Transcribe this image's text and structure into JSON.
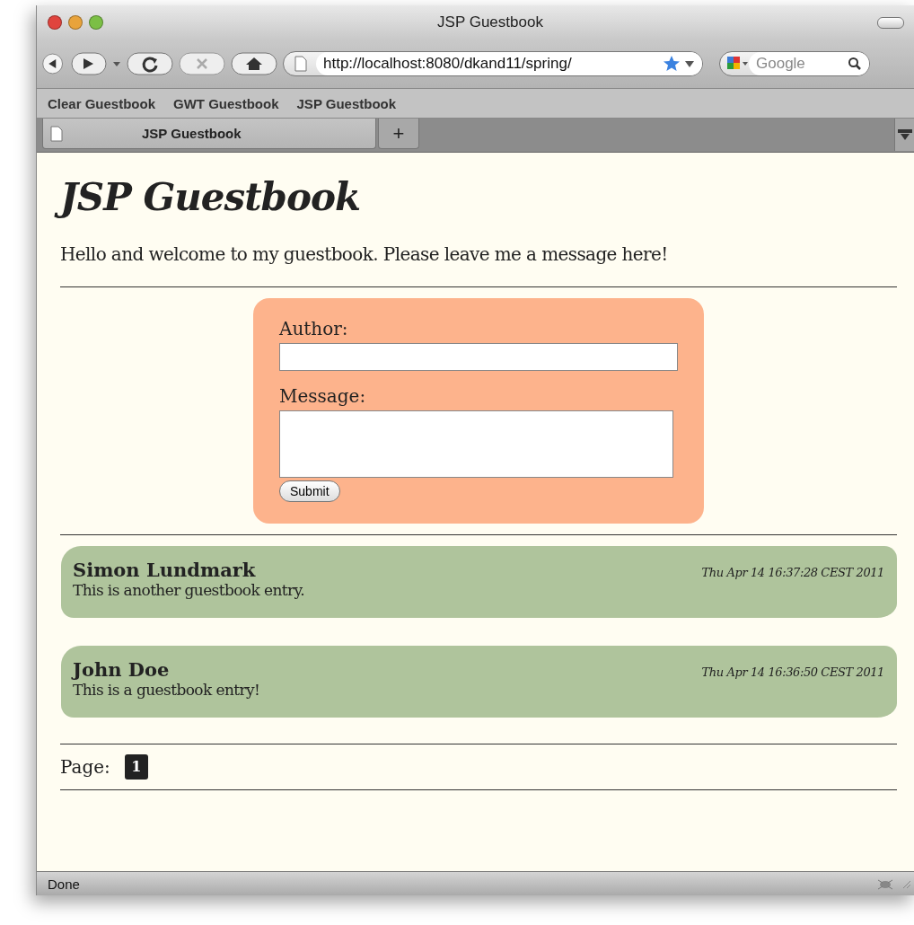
{
  "window": {
    "title": "JSP Guestbook"
  },
  "toolbar": {
    "url": "http://localhost:8080/dkand11/spring/",
    "search_placeholder": "Google"
  },
  "bookmarks": [
    "Clear Guestbook",
    "GWT Guestbook",
    "JSP Guestbook"
  ],
  "tabs": [
    {
      "label": "JSP Guestbook",
      "selected": true
    },
    {
      "label": "+",
      "selected": false
    }
  ],
  "page": {
    "heading": "JSP Guestbook",
    "intro": "Hello and welcome to my guestbook. Please leave me a message here!",
    "form": {
      "author_label": "Author:",
      "message_label": "Message:",
      "submit": "Submit"
    },
    "entries": [
      {
        "author": "Simon Lundmark",
        "date": "Thu Apr 14 16:37:28 CEST 2011",
        "message": "This is another guestbook entry."
      },
      {
        "author": "John Doe",
        "date": "Thu Apr 14 16:36:50 CEST 2011",
        "message": "This is a guestbook entry!"
      }
    ],
    "pagination": {
      "label": "Page:",
      "pages": [
        {
          "label": "1",
          "selected": true
        }
      ]
    }
  },
  "status_bar": "Done"
}
